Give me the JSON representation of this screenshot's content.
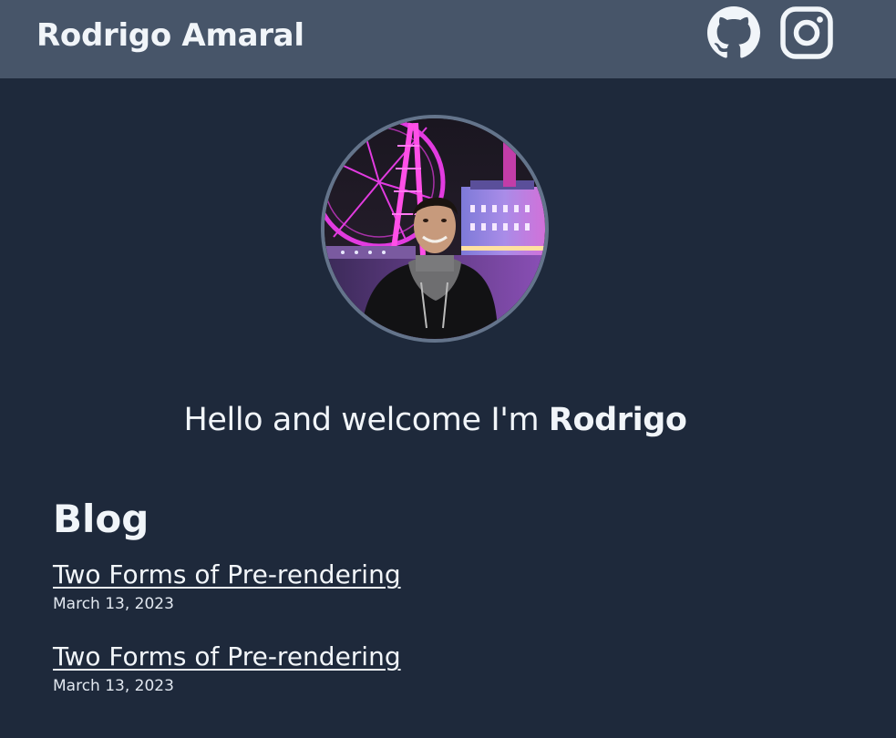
{
  "header": {
    "site_title": "Rodrigo Amaral",
    "social": [
      {
        "name": "github-icon"
      },
      {
        "name": "instagram-icon"
      }
    ]
  },
  "profile": {
    "greeting_prefix": "Hello and welcome I'm ",
    "greeting_name": "Rodrigo"
  },
  "blog": {
    "heading": "Blog",
    "posts": [
      {
        "title": "Two Forms of Pre-rendering",
        "date": "March 13, 2023"
      },
      {
        "title": "Two Forms of Pre-rendering",
        "date": "March 13, 2023"
      }
    ]
  },
  "colors": {
    "page_background": "#1e293b",
    "header_background": "#475569",
    "text": "#f1f5f9",
    "avatar_border": "#64748b"
  }
}
